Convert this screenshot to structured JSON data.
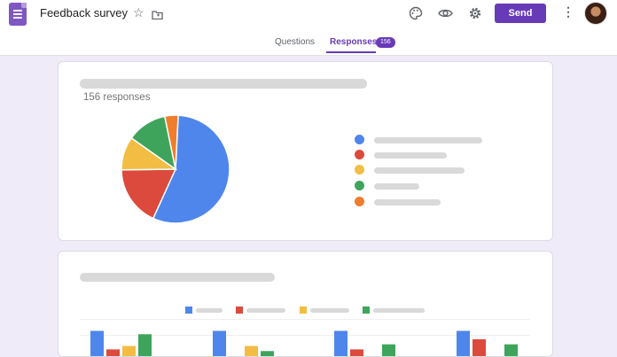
{
  "app": {
    "title": "Feedback survey",
    "brand_color": "#673ab7",
    "icons": [
      "forms-logo-icon",
      "star-icon",
      "folder-icon",
      "palette-icon",
      "eye-icon",
      "gear-icon",
      "more-vert-icon"
    ]
  },
  "header": {
    "send_label": "Send"
  },
  "tabs": [
    {
      "label": "Questions",
      "active": false
    },
    {
      "label": "Responses",
      "active": true,
      "badge": "156"
    }
  ],
  "summary": {
    "responses_label": "156 responses"
  },
  "chart_data": [
    {
      "type": "pie",
      "title": "",
      "slices": [
        {
          "color": "#4f86ec",
          "value": 56
        },
        {
          "color": "#db4a3c",
          "value": 18
        },
        {
          "color": "#f2bd42",
          "value": 10
        },
        {
          "color": "#3fa45b",
          "value": 12
        },
        {
          "color": "#ef7d2c",
          "value": 4
        }
      ],
      "legend": "right"
    },
    {
      "type": "bar",
      "title": "",
      "series_colors": [
        "#4f86ec",
        "#db4a3c",
        "#f2bd42",
        "#3fa45b"
      ],
      "groups": [
        {
          "values": [
            75,
            20,
            30,
            65
          ]
        },
        {
          "values": [
            75,
            0,
            30,
            15
          ]
        },
        {
          "values": [
            75,
            20,
            0,
            35
          ]
        },
        {
          "values": [
            75,
            50,
            0,
            35
          ]
        }
      ],
      "legend": "top"
    }
  ]
}
